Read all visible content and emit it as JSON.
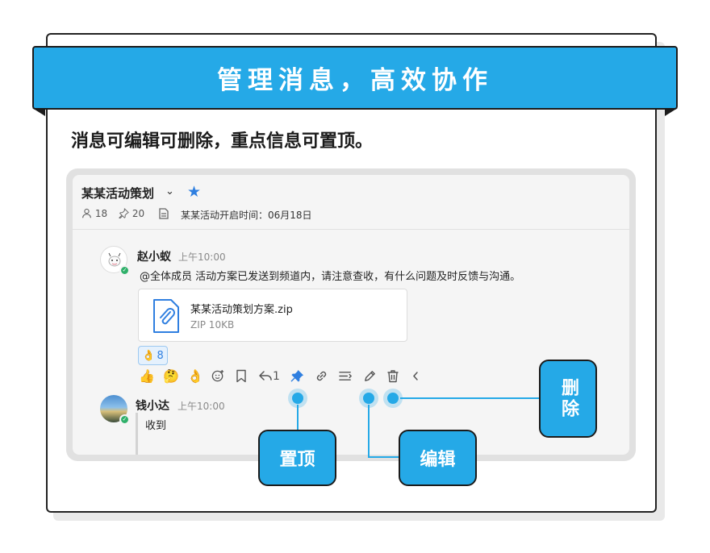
{
  "banner": {
    "title": "管理消息，高效协作"
  },
  "subtitle": "消息可编辑可删除，重点信息可置顶。",
  "channel": {
    "title": "某某活动策划",
    "caret": "⌄",
    "star": "★",
    "members": "18",
    "pins": "20",
    "notice": "某某活动开启时间：06月18日"
  },
  "messages": [
    {
      "name": "赵小蚁",
      "time": "上午10:00",
      "text": "@全体成员 活动方案已发送到频道内，请注意查收，有什么问题及时反馈与沟通。",
      "file": {
        "name": "某某活动策划方案.zip",
        "size": "ZIP 10KB"
      },
      "reaction": {
        "emoji": "👌",
        "count": "8"
      }
    },
    {
      "name": "钱小达",
      "time": "上午10:00",
      "text": "收到"
    }
  ],
  "toolbar": {
    "thumbs": "👍",
    "thinking": "🤔",
    "ok": "👌",
    "reply_count": "1"
  },
  "callouts": {
    "pin": "置顶",
    "edit": "编辑",
    "delete": "删除"
  },
  "colors": {
    "accent": "#25a9e7",
    "pin_active": "#2f7fe0"
  }
}
